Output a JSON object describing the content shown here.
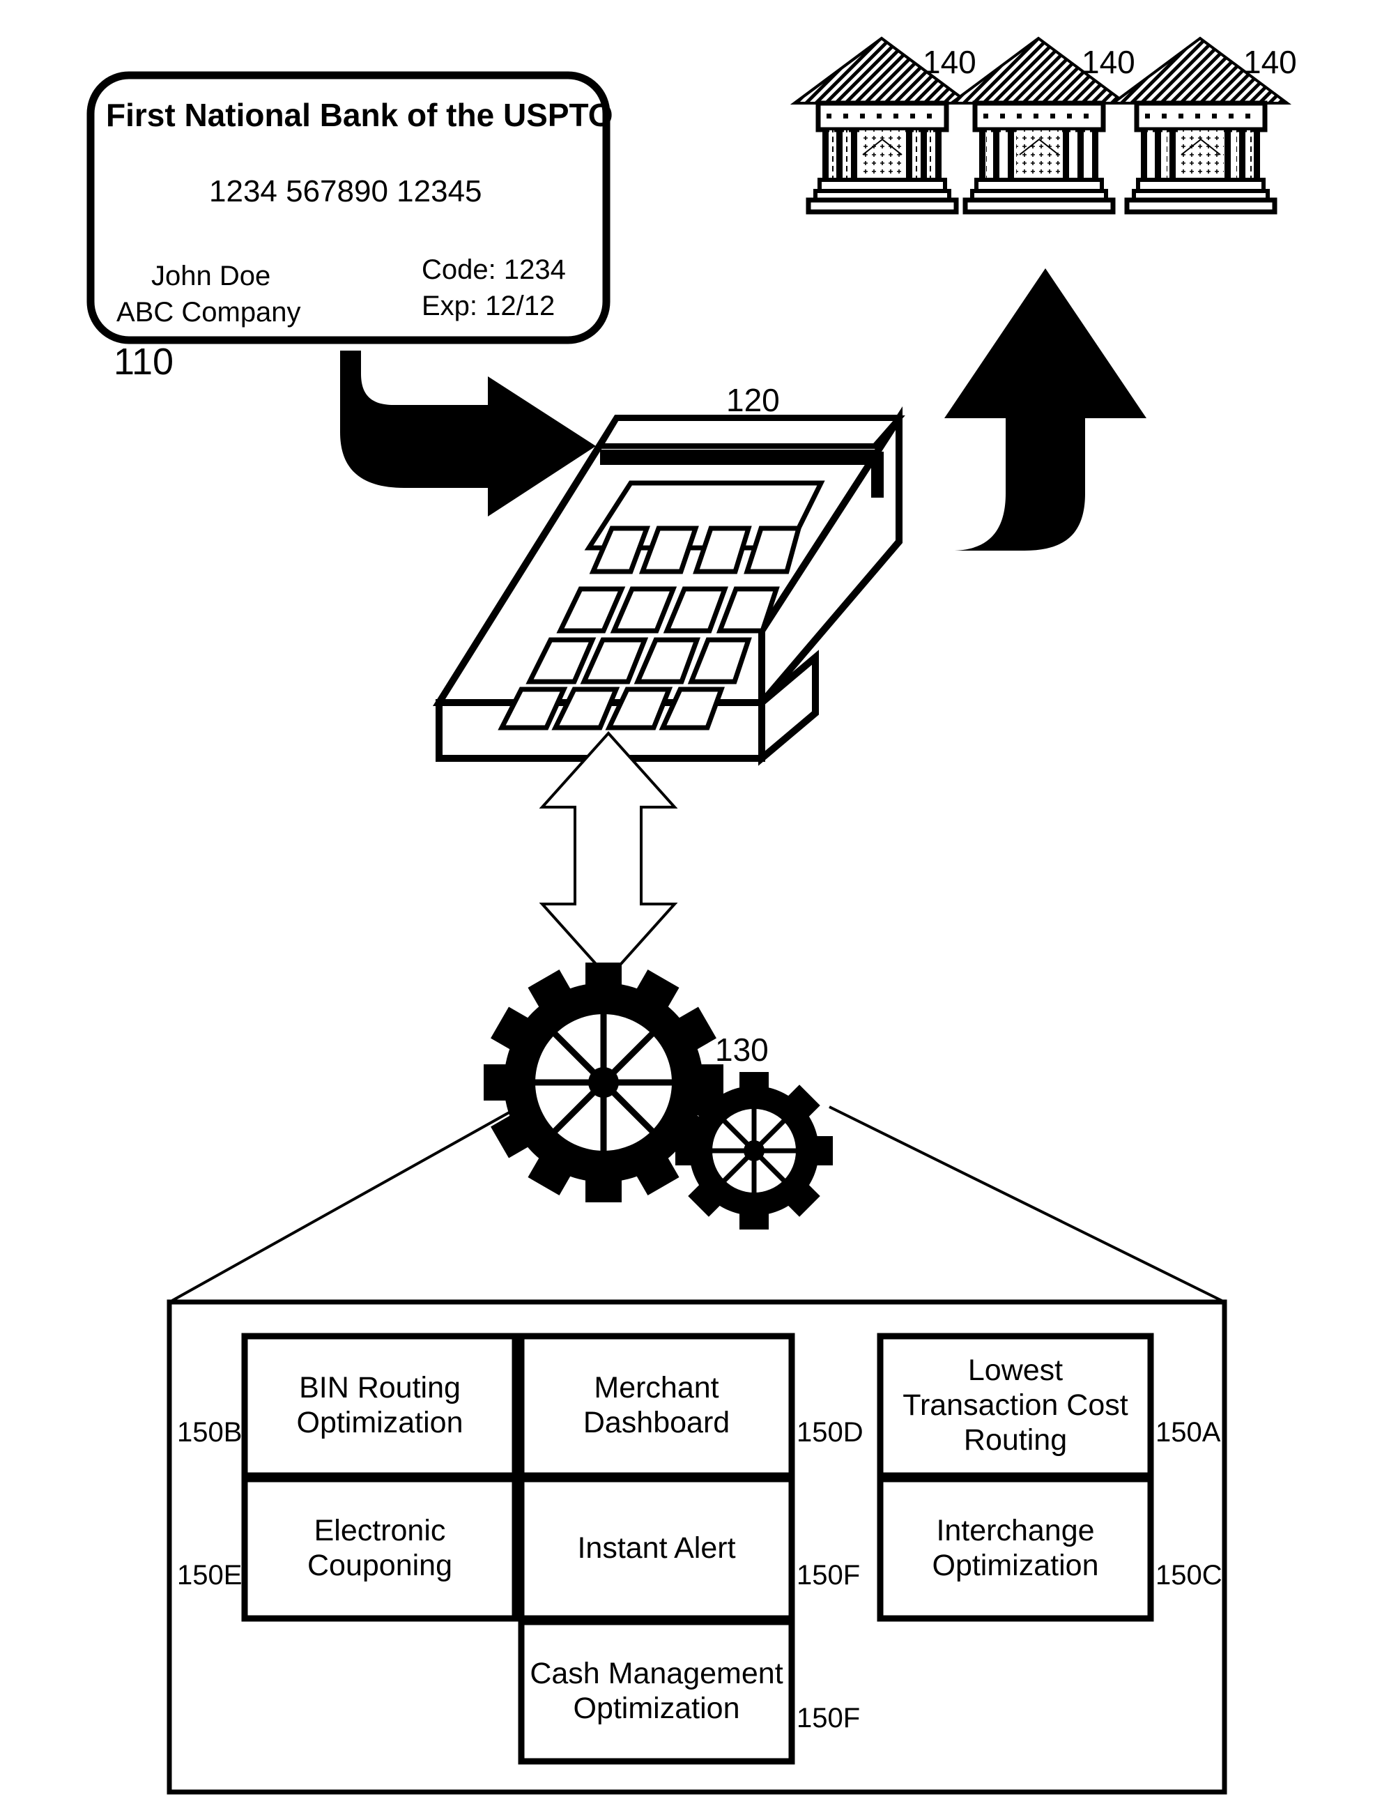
{
  "figure": {
    "type": "patent-figure",
    "background": "#ffffff",
    "ink": "#000000"
  },
  "card": {
    "ref": "110",
    "bank_name": "First National Bank of the USPTO",
    "number": "1234 567890 12345",
    "holder_name": "John Doe",
    "company": "ABC Company",
    "code_line": "Code: 1234",
    "exp_line": "Exp: 12/12"
  },
  "terminal": {
    "ref": "120",
    "name": "point-of-sale-terminal"
  },
  "banks": {
    "refs": [
      "140",
      "140",
      "140"
    ],
    "count": 3,
    "name": "bank-institution"
  },
  "gears": {
    "ref": "130",
    "name": "processing-engine"
  },
  "modules": {
    "container_name": "services-container",
    "items": [
      {
        "label": "BIN Routing Optimization",
        "ref": "150B",
        "ref_side": "left"
      },
      {
        "label": "Merchant Dashboard",
        "ref": "150D",
        "ref_side": "right"
      },
      {
        "label": "Lowest Transaction Cost Routing",
        "ref": "150A",
        "ref_side": "right"
      },
      {
        "label": "Electronic Couponing",
        "ref": "150E",
        "ref_side": "left"
      },
      {
        "label": "Instant Alert",
        "ref": "150F",
        "ref_side": "right"
      },
      {
        "label": "Interchange Optimization",
        "ref": "150C",
        "ref_side": "right"
      },
      {
        "label": "Cash Management Optimization",
        "ref": "150F",
        "ref_side": "right"
      }
    ]
  }
}
